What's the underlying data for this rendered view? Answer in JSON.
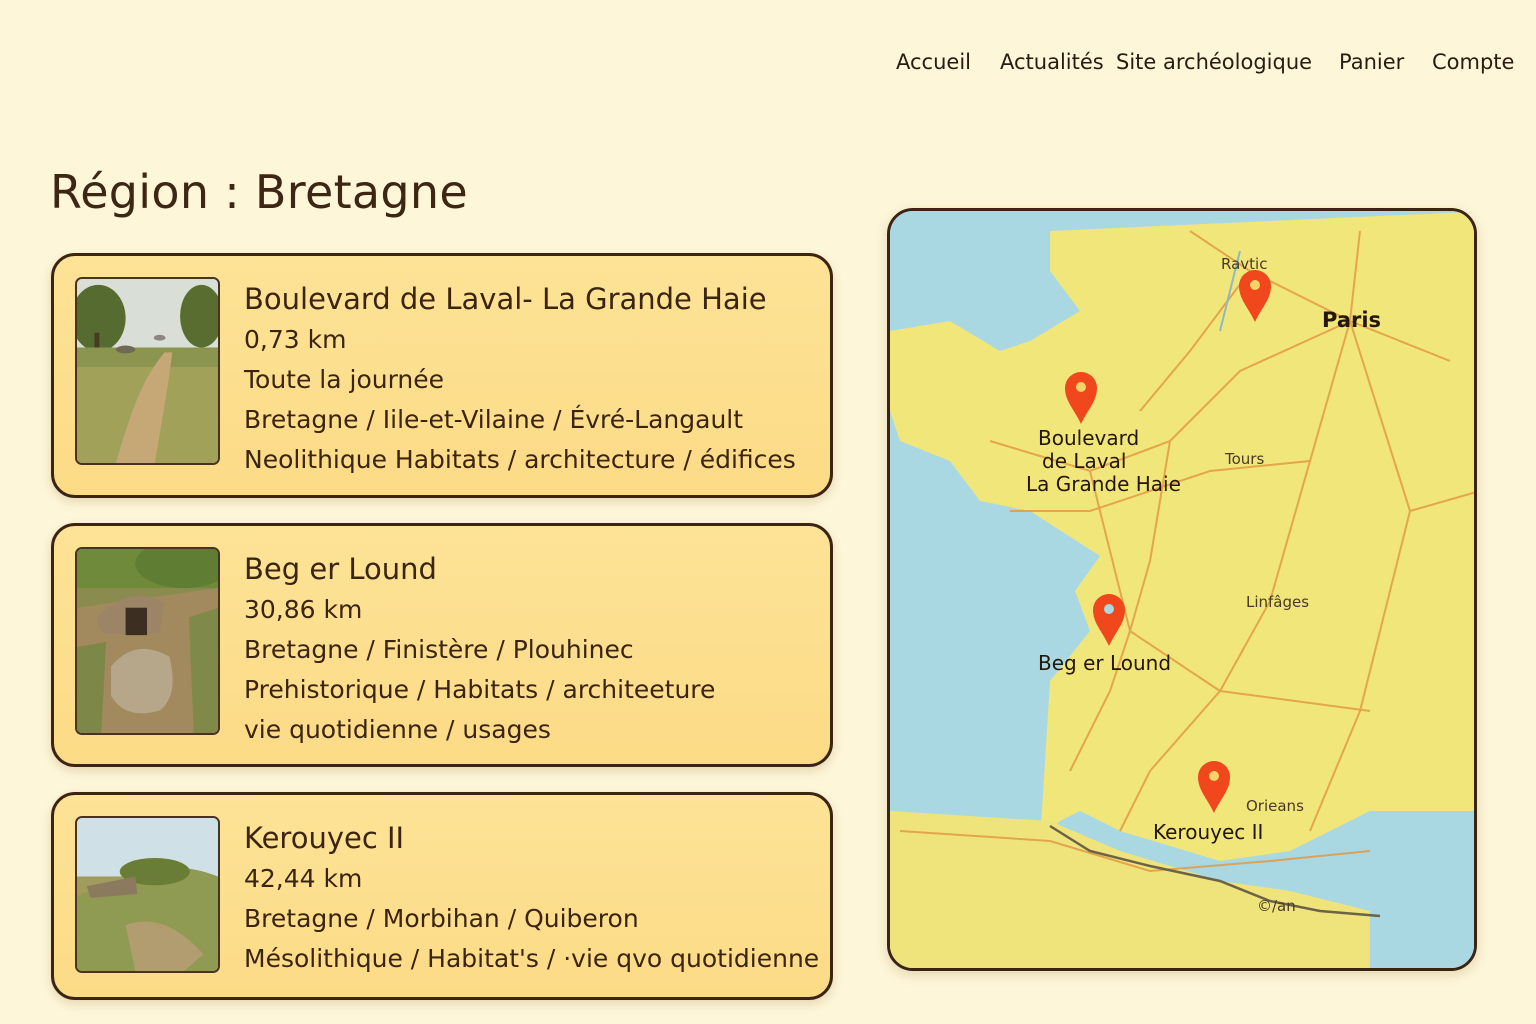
{
  "nav": {
    "items": [
      "Accueil",
      "Actualités",
      "Site archéologique",
      "Panier",
      "Compte"
    ]
  },
  "page": {
    "title": "Région : Bretagne"
  },
  "sites": [
    {
      "title": "Boulevard de Laval- La Grande Haie",
      "lines": [
        "0,73 km",
        "Toute la journée",
        "Bretagne / Iile-et-Vilaine / Évré-Langault",
        "Neolithique Habitats / architecture / édifices"
      ]
    },
    {
      "title": "Beg er Lound",
      "lines": [
        "30,86 km",
        "Bretagne / Finistère / Plouhinec",
        "Prehistorique / Habitats / architeeture",
        "vie quotidienne / usages"
      ]
    },
    {
      "title": "Kerouyec II",
      "lines": [
        "42,44 km",
        "Bretagne / Morbihan / Quiberon",
        "Mésolithique / Habitat's / ·vie qvo quotidienne"
      ]
    }
  ],
  "map": {
    "labels": {
      "ravtic": "Ravtic",
      "paris": "Paris",
      "tours": "Tours",
      "linfages": "Linfâges",
      "orleans": "Orieans",
      "can": "©/an",
      "pin1_line1": "Boulevard",
      "pin1_line2": "de Laval",
      "pin1_line3": "La Grande Haie",
      "pin2": "Beg er Lound",
      "pin3": "Kerouyec II"
    },
    "colors": {
      "sea": "#a9d8e3",
      "land": "#f1e67a",
      "road": "#e39a43",
      "pin": "#f1471d"
    }
  }
}
